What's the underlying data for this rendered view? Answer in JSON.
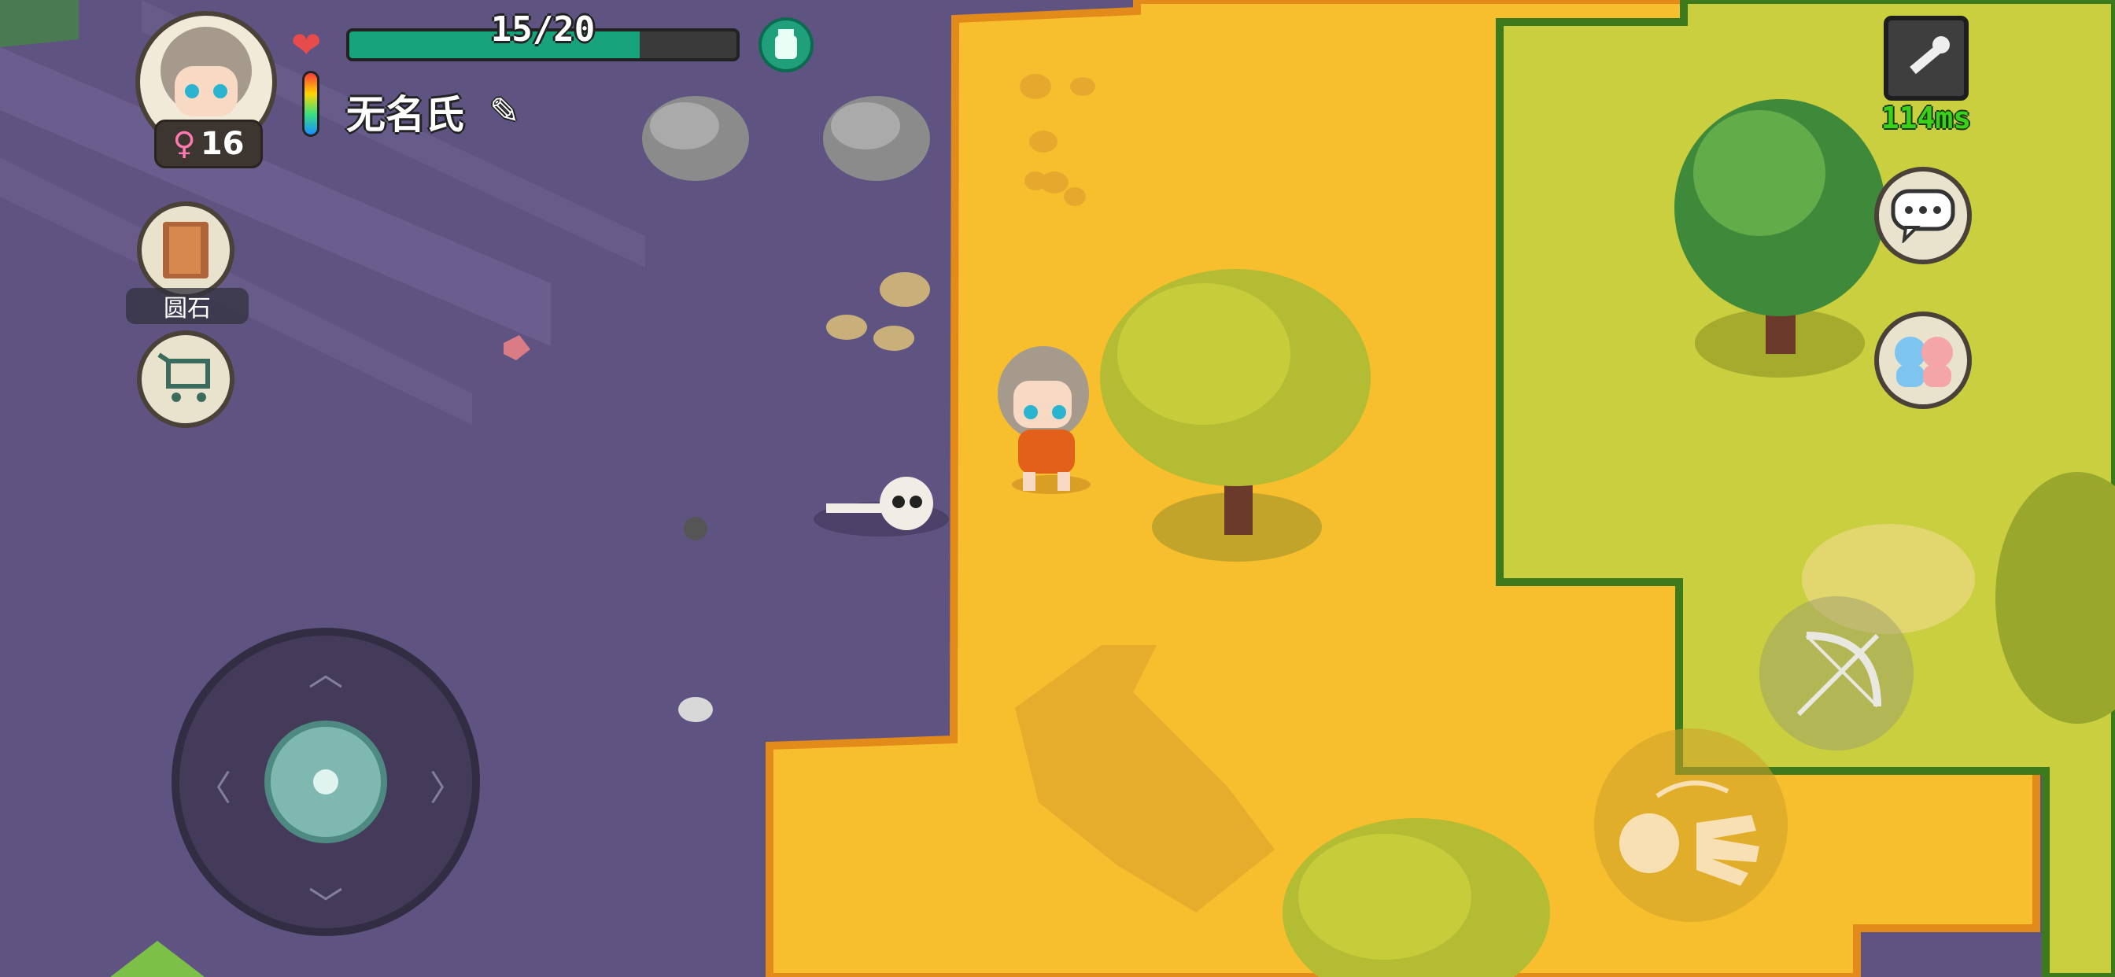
{
  "hud": {
    "health": {
      "current": 15,
      "max": 20,
      "text": "15/20",
      "fill_fraction": 0.75,
      "fill_color": "#17a37c"
    },
    "age": {
      "gender_symbol": "♀",
      "value": "16"
    },
    "player_name": "无名氏",
    "held_item_label": "圆石",
    "ping": "114ms",
    "icons": {
      "heart": "heart-icon",
      "thermometer": "thermometer-icon",
      "food": "food-jar-icon",
      "edit": "pencil-icon",
      "recipe_book": "recipe-book-icon",
      "shop": "shopping-cart-icon",
      "settings": "wrench-icon",
      "chat": "chat-bubble-icon",
      "social": "friends-icon",
      "attack": "bow-icon",
      "interact": "hand-icon"
    }
  },
  "colors": {
    "swamp": "#5f5382",
    "desert": "#f7be2e",
    "grassland": "#c9cf3e",
    "accent_green": "#39d11a"
  }
}
